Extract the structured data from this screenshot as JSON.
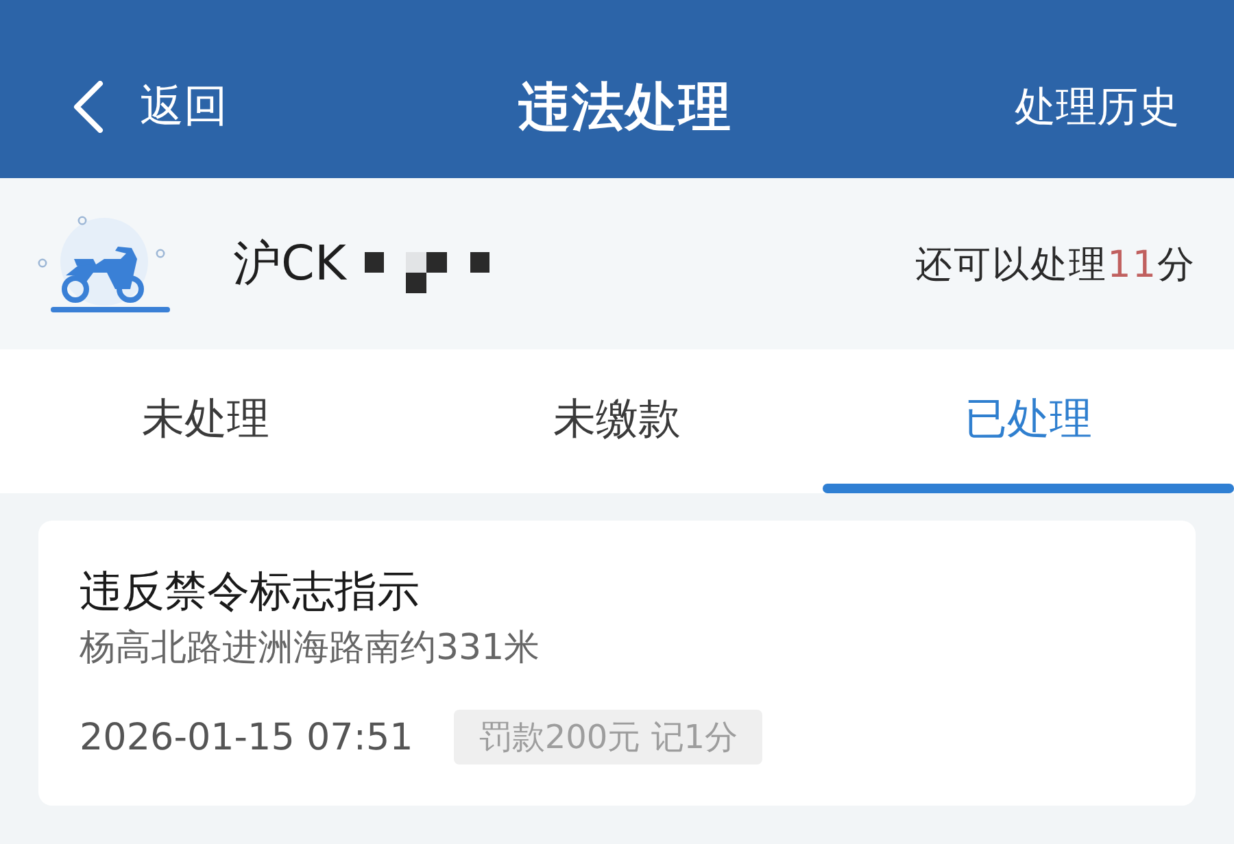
{
  "header": {
    "back_label": "返回",
    "title": "违法处理",
    "history_label": "处理历史"
  },
  "vehicle": {
    "plate": "沪CK",
    "remaining_points": {
      "before": "还可以处理",
      "value": "11",
      "after": "分"
    }
  },
  "tabs": [
    {
      "label": "未处理",
      "selected": false
    },
    {
      "label": "未缴款",
      "selected": false
    },
    {
      "label": "已处理",
      "selected": true
    }
  ],
  "violations": [
    {
      "title": "违反禁令标志指示",
      "location": "杨高北路进洲海路南约331米",
      "time": "2026-01-15 07:51",
      "penalty": "罚款200元 记1分"
    }
  ]
}
